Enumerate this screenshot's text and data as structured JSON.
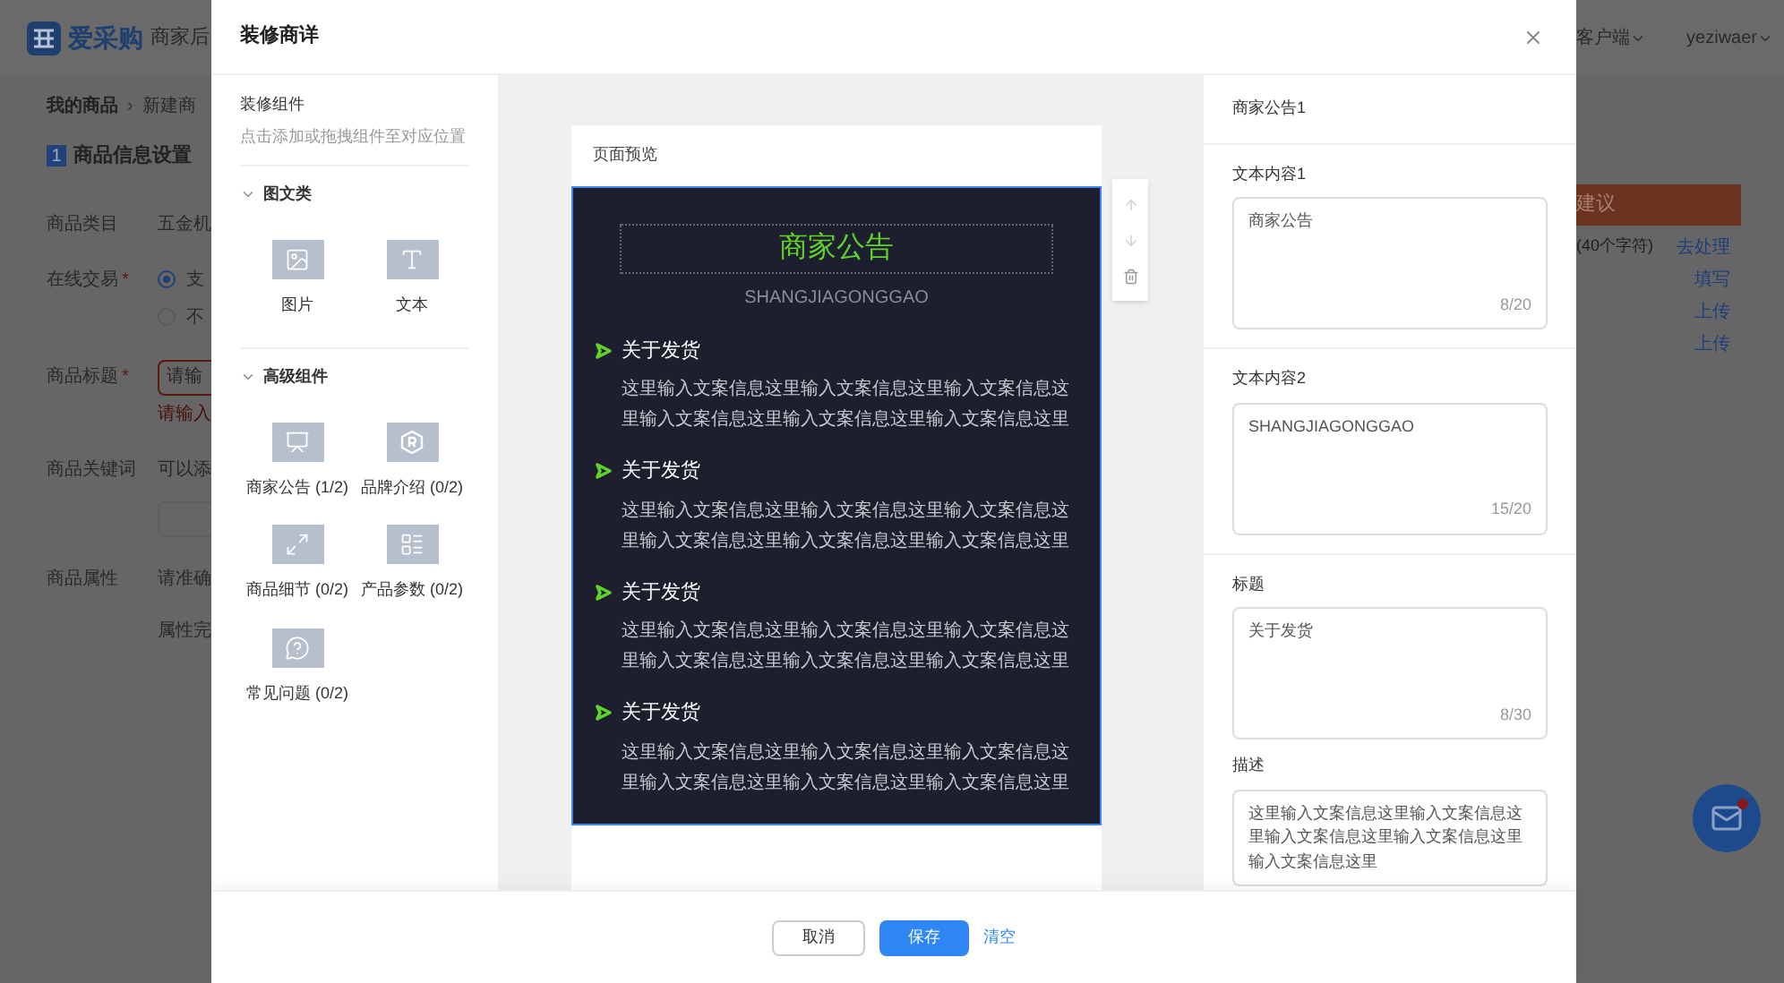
{
  "background": {
    "logo": {
      "brand": "爱采购",
      "suffix": "商家后"
    },
    "breadcrumb": [
      "我的商品",
      "新建商"
    ],
    "breadcrumb_separator": "›",
    "section": {
      "number": "1",
      "title": "商品信息设置"
    },
    "form_rows": [
      {
        "kind": "text",
        "label": "商品类目",
        "value": "五金机"
      },
      {
        "kind": "radio",
        "label": "在线交易",
        "required_mark": "*",
        "options": [
          {
            "label": "支",
            "selected": true
          },
          {
            "label": "不",
            "selected": false
          }
        ]
      },
      {
        "kind": "input",
        "label": "商品标题",
        "required_mark": "*",
        "placeholder": "请输",
        "error": "请输入"
      },
      {
        "kind": "hint_input",
        "label": "商品关键词",
        "hint": "可以添"
      },
      {
        "kind": "text",
        "label": "商品属性",
        "value": "请准确",
        "note": "属性完"
      }
    ],
    "top_right": {
      "client": "客户端",
      "user": "yeziwaer"
    },
    "banner": "建议",
    "hint": "(40个字符)",
    "links": [
      "去处理",
      "填写",
      "上传",
      "上传"
    ]
  },
  "modal": {
    "title": "装修商详",
    "components": {
      "title": "装修组件",
      "hint": "点击添加或拖拽组件至对应位置",
      "groups": [
        {
          "title": "图文类",
          "expanded": true,
          "items": [
            {
              "kind": "image",
              "label": "图片"
            },
            {
              "kind": "text",
              "label": "文本"
            }
          ]
        },
        {
          "title": "高级组件",
          "expanded": true,
          "items": [
            {
              "kind": "notice",
              "label": "商家公告 (1/2)"
            },
            {
              "kind": "brand",
              "label": "品牌介绍 (0/2)"
            },
            {
              "kind": "detail",
              "label": "商品细节 (0/2)"
            },
            {
              "kind": "params",
              "label": "产品参数 (0/2)"
            },
            {
              "kind": "faq",
              "label": "常见问题 (0/2)"
            }
          ]
        }
      ]
    },
    "preview": {
      "title": "页面预览",
      "selected": true,
      "heading": "商家公告",
      "subheading": "SHANGJIAGONGGAO",
      "items": [
        {
          "title": "关于发货",
          "text": "这里输入文案信息这里输入文案信息这里输入文案信息这里输入文案信息这里输入文案信息这里输入文案信息这里"
        },
        {
          "title": "关于发货",
          "text": "这里输入文案信息这里输入文案信息这里输入文案信息这里输入文案信息这里输入文案信息这里输入文案信息这里"
        },
        {
          "title": "关于发货",
          "text": "这里输入文案信息这里输入文案信息这里输入文案信息这里输入文案信息这里输入文案信息这里输入文案信息这里"
        },
        {
          "title": "关于发货",
          "text": "这里输入文案信息这里输入文案信息这里输入文案信息这里输入文案信息这里输入文案信息这里输入文案信息这里"
        }
      ]
    },
    "settings": {
      "title": "商家公告1",
      "sections": [
        [
          {
            "label": "文本内容1",
            "value": "商家公告",
            "counter": "8/20"
          }
        ],
        [
          {
            "label": "文本内容2",
            "value": "SHANGJIAGONGGAO",
            "counter": "15/20"
          }
        ],
        [
          {
            "label": "标题",
            "value": "关于发货",
            "counter": "8/30"
          },
          {
            "label": "描述",
            "value": "这里输入文案信息这里输入文案信息这里输入文案信息这里输入文案信息这里输入文案信息这里"
          }
        ]
      ]
    },
    "buttons": [
      {
        "kind": "default",
        "label": "取消"
      },
      {
        "kind": "primary",
        "label": "保存"
      },
      {
        "kind": "link",
        "label": "清空"
      }
    ]
  }
}
